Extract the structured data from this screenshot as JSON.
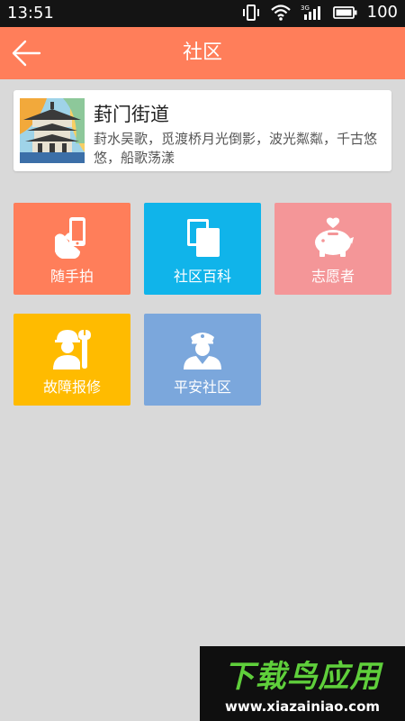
{
  "status_bar": {
    "time": "13:51",
    "battery": "100",
    "network": "3G"
  },
  "header": {
    "title": "社区"
  },
  "intro": {
    "name": "葑门街道",
    "description": "葑水吴歌，觅渡桥月光倒影，波光粼粼，千古悠悠，船歌荡漾"
  },
  "tiles": [
    {
      "label": "随手拍",
      "icon": "hand-phone-icon",
      "color": "#ff7e5a"
    },
    {
      "label": "社区百科",
      "icon": "documents-icon",
      "color": "#10b4ea"
    },
    {
      "label": "志愿者",
      "icon": "piggy-bank-heart-icon",
      "color": "#f49698"
    },
    {
      "label": "故障报修",
      "icon": "repair-worker-icon",
      "color": "#ffbb00"
    },
    {
      "label": "平安社区",
      "icon": "police-officer-icon",
      "color": "#7ba7dc"
    }
  ],
  "watermark": {
    "title": "下载鸟应用",
    "url": "www.xiazainiao.com"
  }
}
